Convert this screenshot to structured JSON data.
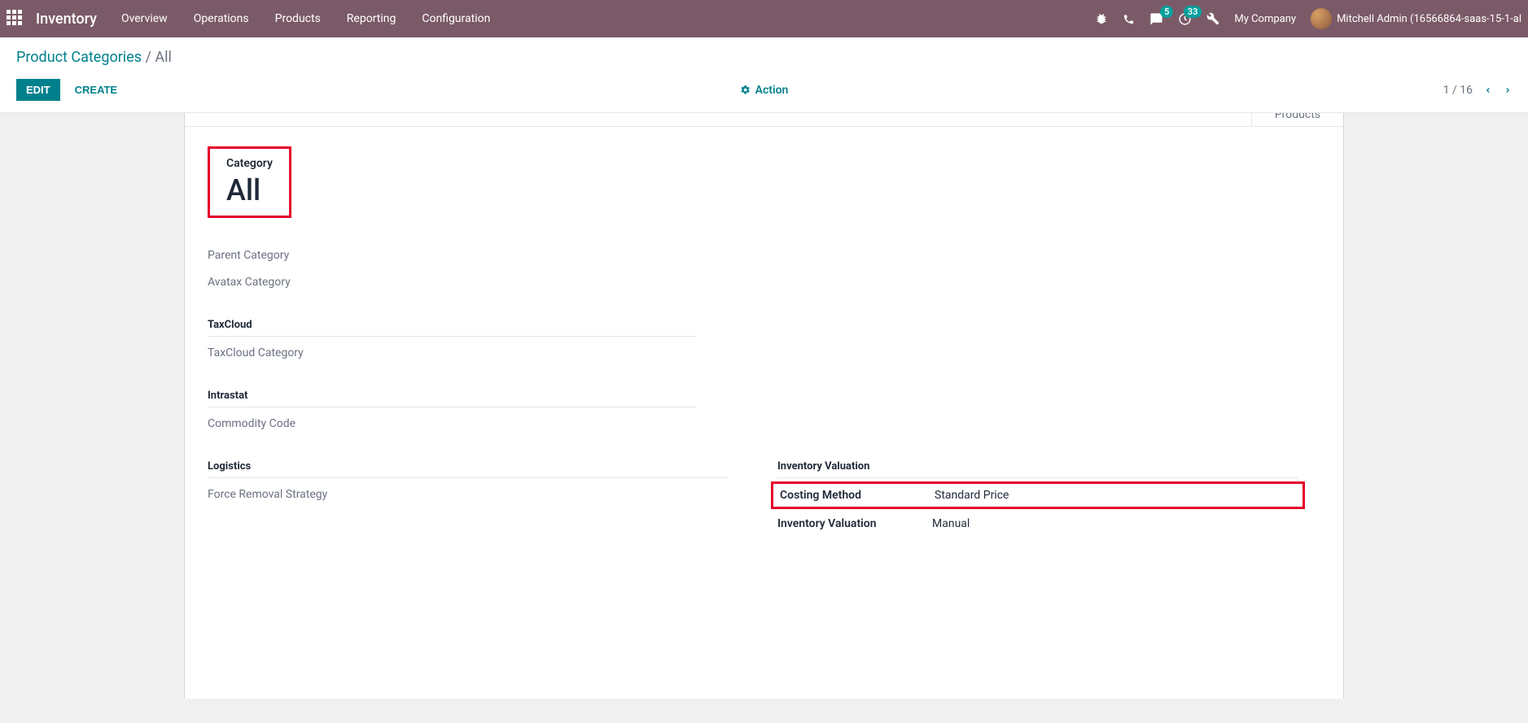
{
  "nav": {
    "brand": "Inventory",
    "links": [
      "Overview",
      "Operations",
      "Products",
      "Reporting",
      "Configuration"
    ],
    "msg_badge": "5",
    "activity_badge": "33",
    "company": "My Company",
    "user": "Mitchell Admin (16566864-saas-15-1-al"
  },
  "breadcrumb": {
    "parent": "Product Categories",
    "current": "All"
  },
  "controls": {
    "edit": "EDIT",
    "create": "CREATE",
    "action": "Action",
    "pager": "1 / 16"
  },
  "statbtn": {
    "products": "Products"
  },
  "form": {
    "category_label": "Category",
    "category_value": "All",
    "parent_category_label": "Parent Category",
    "avatax_category_label": "Avatax Category",
    "taxcloud_section": "TaxCloud",
    "taxcloud_category_label": "TaxCloud Category",
    "intrastat_section": "Intrastat",
    "commodity_code_label": "Commodity Code",
    "logistics_section": "Logistics",
    "force_removal_label": "Force Removal Strategy",
    "inv_val_section": "Inventory Valuation",
    "costing_method_label": "Costing Method",
    "costing_method_value": "Standard Price",
    "inventory_valuation_label": "Inventory Valuation",
    "inventory_valuation_value": "Manual"
  }
}
